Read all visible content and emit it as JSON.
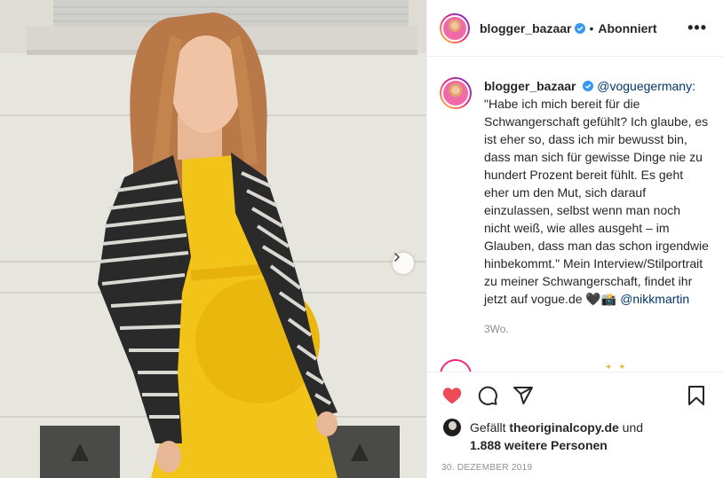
{
  "post": {
    "username": "blogger_bazaar",
    "follow_state": "Abonniert",
    "more_label": "•••"
  },
  "caption": {
    "username": "blogger_bazaar",
    "mention": "@voguegermany",
    "text_1": ": \"Habe ich mich bereit für die Schwangerschaft gefühlt? Ich glaube, es ist eher so, dass ich mir bewusst bin, dass man sich für gewisse Dinge nie zu hundert Prozent bereit fühlt. Es geht eher um den Mut, sich darauf einzulassen, selbst wenn man noch nicht weiß, wie alles ausgeht – im Glauben, dass man das schon irgendwie hinbekommt.\" Mein Interview/Stilportrait zu meiner Schwangerschaft, findet ihr jetzt auf vogue.de ",
    "emojis": "🖤📸",
    "tag": "@nikkmartin",
    "time_ago": "3Wo."
  },
  "likes": {
    "prefix": "Gefällt ",
    "liker": "theoriginalcopy.de",
    "middle": " und",
    "others": "1.888 weitere Personen"
  },
  "date": "30. Dezember 2019",
  "icons": {
    "like": "heart-filled-icon",
    "comment": "comment-bubble-icon",
    "share": "paper-plane-icon",
    "save": "bookmark-icon",
    "carousel_next": "chevron-right-icon",
    "verified": "verified-badge-icon"
  },
  "colors": {
    "like_red": "#ed4956",
    "verified_blue": "#3897f0",
    "link_blue": "#00376b",
    "muted_text": "#8e8e8e",
    "dress_yellow": "#f2c318"
  }
}
